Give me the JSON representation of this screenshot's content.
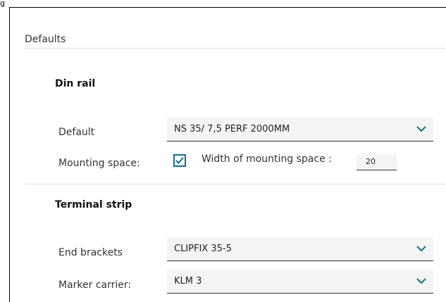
{
  "window": {
    "title_fragment": "g"
  },
  "section": {
    "title": "Defaults"
  },
  "din_rail": {
    "title": "Din rail",
    "default_label": "Default",
    "default_value": "NS 35/ 7,5 PERF 2000MM",
    "mounting_space_label": "Mounting space:",
    "mounting_space_checked": true,
    "width_label": "Width of mounting space :",
    "width_value": "20"
  },
  "terminal_strip": {
    "title": "Terminal strip",
    "end_brackets_label": "End brackets",
    "end_brackets_value": "CLIPFIX 35-5",
    "marker_carrier_label": "Marker carrier:",
    "marker_carrier_value": "KLM 3"
  },
  "colors": {
    "accent": "#0f6e91",
    "field_bg": "#f4f4f4"
  },
  "icons": {
    "dropdown": "chevron-down-icon",
    "check": "checkmark-icon"
  }
}
